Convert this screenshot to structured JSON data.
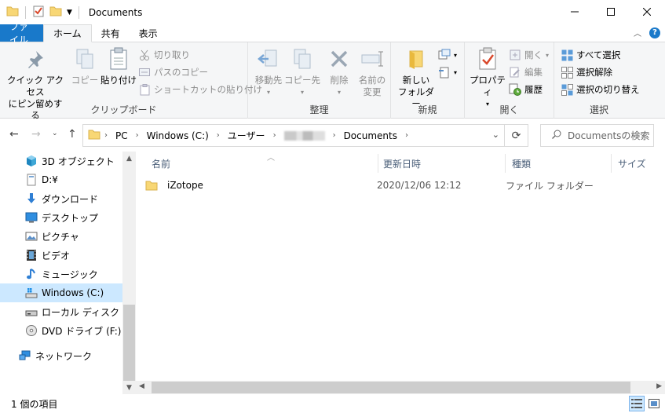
{
  "window": {
    "title": "Documents"
  },
  "tabs": {
    "file": "ファイル",
    "home": "ホーム",
    "share": "共有",
    "view": "表示"
  },
  "ribbon": {
    "clipboard": {
      "label": "クリップボード",
      "pin_line1": "クイック アクセス",
      "pin_line2": "にピン留めする",
      "copy": "コピー",
      "paste": "貼り付け",
      "cut": "切り取り",
      "copy_path": "パスのコピー",
      "paste_shortcut": "ショートカットの貼り付け"
    },
    "organize": {
      "label": "整理",
      "move_to": "移動先",
      "copy_to": "コピー先",
      "delete": "削除",
      "rename_line1": "名前の",
      "rename_line2": "変更"
    },
    "new": {
      "label": "新規",
      "new_folder_line1": "新しい",
      "new_folder_line2": "フォルダー"
    },
    "open": {
      "label": "開く",
      "properties": "プロパティ",
      "open": "開く",
      "edit": "編集",
      "history": "履歴"
    },
    "select": {
      "label": "選択",
      "select_all": "すべて選択",
      "select_none": "選択解除",
      "invert": "選択の切り替え"
    }
  },
  "address": {
    "crumbs": [
      "PC",
      "Windows (C:)",
      "ユーザー",
      "Documents"
    ],
    "search_placeholder": "Documentsの検索"
  },
  "nav_pane": {
    "items": [
      {
        "label": "3D オブジェクト",
        "icon": "3d-objects-icon"
      },
      {
        "label": "D:¥",
        "icon": "drive-icon"
      },
      {
        "label": "ダウンロード",
        "icon": "download-icon"
      },
      {
        "label": "デスクトップ",
        "icon": "desktop-icon"
      },
      {
        "label": "ピクチャ",
        "icon": "pictures-icon"
      },
      {
        "label": "ビデオ",
        "icon": "videos-icon"
      },
      {
        "label": "ミュージック",
        "icon": "music-icon"
      },
      {
        "label": "Windows (C:)",
        "icon": "windows-drive-icon",
        "selected": true
      },
      {
        "label": "ローカル ディスク (D:)",
        "icon": "local-disk-icon"
      },
      {
        "label": "DVD ドライブ (F:) Auc",
        "icon": "dvd-drive-icon"
      },
      {
        "label": "ネットワーク",
        "icon": "network-icon"
      }
    ]
  },
  "columns": {
    "name": "名前",
    "date": "更新日時",
    "type": "種類",
    "size": "サイズ"
  },
  "files": [
    {
      "name": "iZotope",
      "date": "2020/12/06 12:12",
      "type": "ファイル フォルダー",
      "size": ""
    }
  ],
  "status": {
    "count": "1 個の項目"
  },
  "colors": {
    "accent": "#1979ca",
    "selection": "#cce8ff",
    "folder": "#f8d775"
  }
}
